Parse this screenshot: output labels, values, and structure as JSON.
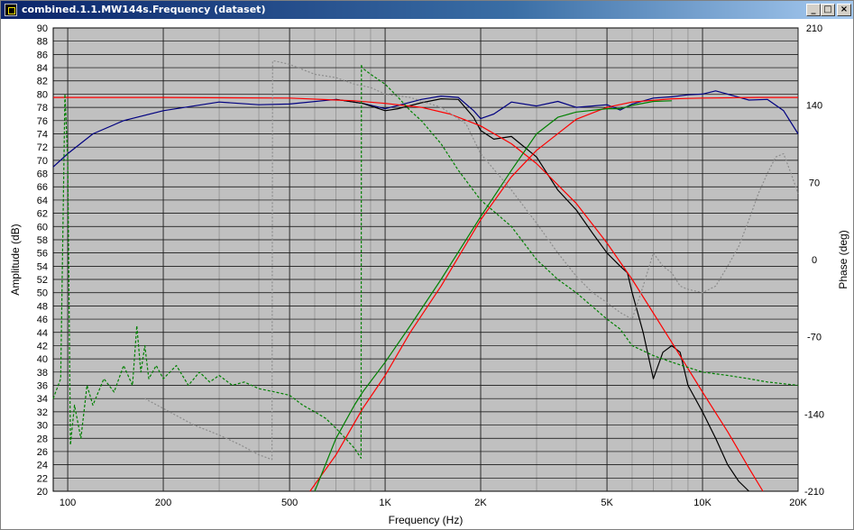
{
  "window": {
    "title": "combined.1.1.MW144s.Frequency (dataset)"
  },
  "titlebar_buttons": {
    "minimize": "_",
    "maximize": "□",
    "close": "×"
  },
  "chart_data": {
    "type": "line",
    "xlabel": "Frequency (Hz)",
    "ylabel": "Amplitude (dB)",
    "y2label": "Phase (deg)",
    "xscale": "log",
    "xlim": [
      90,
      20000
    ],
    "ylim": [
      20,
      90
    ],
    "y2lim": [
      -210,
      210
    ],
    "grid": true,
    "x_ticks": [
      {
        "v": 100,
        "label": "100"
      },
      {
        "v": 200,
        "label": "200"
      },
      {
        "v": 500,
        "label": "500"
      },
      {
        "v": 1000,
        "label": "1K"
      },
      {
        "v": 2000,
        "label": "2K"
      },
      {
        "v": 5000,
        "label": "5K"
      },
      {
        "v": 10000,
        "label": "10K"
      },
      {
        "v": 20000,
        "label": "20K"
      }
    ],
    "y_ticks": [
      20,
      22,
      24,
      26,
      28,
      30,
      32,
      34,
      36,
      38,
      40,
      42,
      44,
      46,
      48,
      50,
      52,
      54,
      56,
      58,
      60,
      62,
      64,
      66,
      68,
      70,
      72,
      74,
      76,
      78,
      80,
      82,
      84,
      86,
      88,
      90
    ],
    "y2_ticks": [
      -210,
      -140,
      -70,
      0,
      70,
      140,
      210
    ],
    "colors": {
      "plot_bg": "#c0c0c0",
      "grid": "#000000",
      "blue": "#000080",
      "black": "#000000",
      "red": "#ff0000",
      "green": "#008000",
      "gray": "#8c8c8c"
    },
    "series": [
      {
        "axis": "left",
        "color": "#000080",
        "dash": "",
        "x": [
          90,
          100,
          120,
          150,
          200,
          300,
          400,
          500,
          700,
          850,
          1000,
          1100,
          1300,
          1500,
          1700,
          1900,
          2000,
          2200,
          2500,
          3000,
          3500,
          4000,
          4500,
          5000,
          5500,
          6000,
          7000,
          8000,
          9000,
          10000,
          11000,
          12000,
          14000,
          16000,
          18000,
          20000
        ],
        "y": [
          69,
          71,
          74,
          76,
          77.5,
          78.8,
          78.4,
          78.5,
          79.2,
          78.6,
          77.8,
          78.3,
          79.2,
          79.7,
          79.5,
          77.5,
          76.3,
          77,
          78.8,
          78.2,
          78.9,
          78,
          78.2,
          78.4,
          77.6,
          78.5,
          79.4,
          79.6,
          79.9,
          80,
          80.5,
          80,
          79.1,
          79.2,
          77.5,
          74
        ]
      },
      {
        "axis": "left",
        "color": "#000000",
        "dash": "",
        "x": [
          700,
          850,
          1000,
          1100,
          1300,
          1500,
          1700,
          1900,
          2000,
          2200,
          2500,
          3000,
          3500,
          4000,
          4500,
          5000,
          5500,
          5800,
          6000,
          6500,
          7000,
          7500,
          8000,
          8500,
          9000,
          10000,
          11000,
          12000,
          13000,
          14000
        ],
        "y": [
          79.2,
          78.6,
          77.5,
          77.8,
          78.7,
          79.3,
          79.2,
          76.5,
          74.5,
          73.2,
          73.6,
          70.5,
          65.5,
          62.5,
          59,
          56,
          54,
          53,
          50,
          44,
          37,
          41,
          42,
          41,
          36,
          32,
          28,
          24,
          21.5,
          20
        ]
      },
      {
        "axis": "left",
        "color": "#ff0000",
        "dash": "",
        "x": [
          90,
          200,
          500,
          800,
          1000,
          1300,
          1600,
          2000,
          2500,
          3000,
          4000,
          5000,
          6000,
          8000,
          10000,
          12000,
          14000,
          15500
        ],
        "y": [
          79.5,
          79.5,
          79.4,
          79,
          78.6,
          78,
          77,
          75.2,
          72.5,
          69.5,
          63.5,
          57.5,
          52,
          42.5,
          35,
          29,
          23.5,
          20
        ]
      },
      {
        "axis": "left",
        "color": "#ff0000",
        "dash": "",
        "x": [
          580,
          700,
          850,
          1000,
          1200,
          1500,
          2000,
          2500,
          3000,
          4000,
          5000,
          6000,
          8000,
          10000,
          15000,
          20000
        ],
        "y": [
          20,
          25.5,
          32.5,
          37.5,
          44,
          51,
          61,
          67.5,
          71.5,
          76.2,
          78,
          78.8,
          79.3,
          79.4,
          79.5,
          79.5
        ]
      },
      {
        "axis": "left",
        "color": "#008000",
        "dash": "",
        "x": [
          600,
          700,
          800,
          850,
          1000,
          1200,
          1500,
          2000,
          2500,
          3000,
          3500,
          4000,
          5000,
          5500,
          6000,
          7000,
          8000
        ],
        "y": [
          20,
          28,
          33,
          35,
          39.5,
          45,
          52,
          61.5,
          68.5,
          74,
          76.5,
          77.3,
          77.8,
          77.8,
          78.3,
          78.9,
          79
        ]
      },
      {
        "axis": "left",
        "color": "#008000",
        "dash": "3,2",
        "x": [
          90,
          95,
          98,
          100,
          102,
          105,
          110,
          115,
          120,
          130,
          140,
          150,
          160,
          165,
          170,
          175,
          180,
          190,
          200,
          220,
          240,
          260,
          280,
          300,
          330,
          360,
          400,
          450,
          500,
          550,
          600,
          650,
          700,
          750,
          800,
          840,
          842,
          845,
          900,
          1000,
          1100,
          1200,
          1300,
          1500,
          1700,
          2000,
          2500,
          3000,
          3500,
          4000,
          5000,
          5500,
          6000,
          7000,
          8000,
          10000,
          12000,
          14000,
          16000,
          20000
        ],
        "y": [
          34,
          37,
          80,
          70,
          27,
          33,
          28,
          36,
          33,
          37,
          35,
          39,
          36,
          45,
          38,
          42,
          37,
          39,
          37,
          39,
          36,
          38,
          36.5,
          37.5,
          36,
          36.5,
          35.5,
          35,
          34.5,
          33,
          32,
          31,
          29.5,
          28,
          26.5,
          25,
          84.5,
          84,
          83,
          81.5,
          79.5,
          77.5,
          76,
          72.5,
          68.5,
          64,
          60,
          55,
          52,
          50,
          46,
          44.5,
          42,
          40.5,
          39.5,
          38,
          37.5,
          37,
          36.5,
          36
        ]
      },
      {
        "axis": "left",
        "color": "#8c8c8c",
        "dash": "2,2",
        "x": [
          175,
          200,
          250,
          300,
          350,
          400,
          440,
          442,
          450,
          500,
          600,
          700,
          800,
          900,
          1000,
          1200,
          1500,
          1800,
          2000,
          2500,
          3000,
          3500,
          4000,
          4500,
          5000,
          5500,
          6000,
          6500,
          7000,
          7500,
          8000,
          8500,
          9000,
          10000,
          11000,
          12000,
          13000,
          14000,
          15000,
          16000,
          17000,
          18000,
          19000,
          20000
        ],
        "y": [
          34,
          32.5,
          30,
          28.5,
          27,
          25.5,
          24.8,
          85,
          85,
          84.5,
          83,
          82.5,
          81.5,
          81,
          80,
          79.5,
          78,
          75.5,
          71,
          65.5,
          60.5,
          56,
          52.5,
          50,
          48.5,
          47,
          46,
          51,
          56,
          54,
          53,
          51,
          50.5,
          50,
          51,
          54,
          57,
          61,
          65,
          68,
          70.5,
          71,
          68,
          65
        ]
      }
    ]
  }
}
